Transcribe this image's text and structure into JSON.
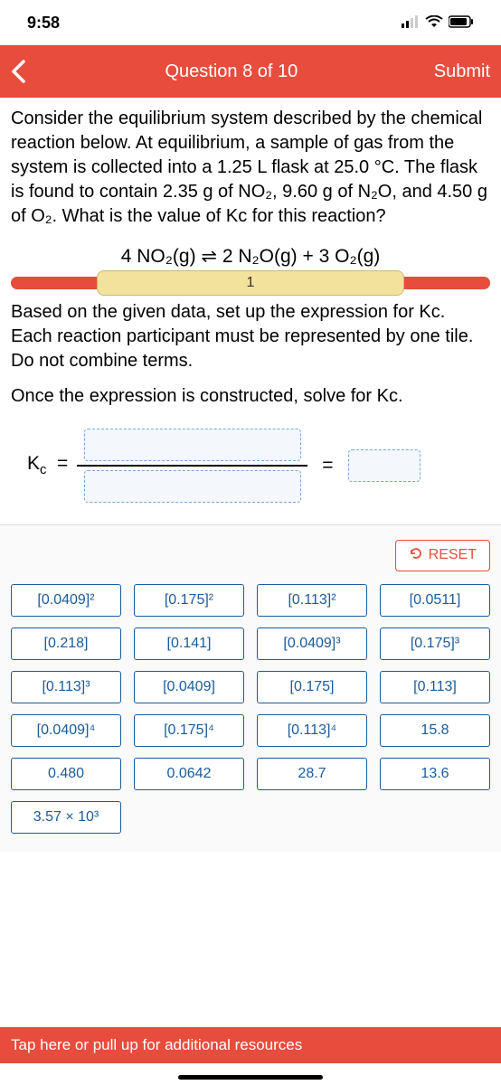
{
  "status": {
    "time": "9:58"
  },
  "nav": {
    "title": "Question 8 of 10",
    "submit": "Submit"
  },
  "question": {
    "prompt": "Consider the equilibrium system described by the chemical reaction below. At equilibrium, a sample of gas from the system is collected into a 1.25 L flask at 25.0 °C. The flask is found to contain 2.35 g of NO₂, 9.60 g of N₂O, and 4.50 g of O₂. What is the value of Kc for this reaction?",
    "equation": "4 NO₂(g)  ⇌ 2 N₂O(g) + 3 O₂(g)",
    "step": "1",
    "instruction1": "Based on the given data, set up the expression for Kc. Each reaction participant must be represented by one tile. Do not combine terms.",
    "instruction2": "Once the expression is constructed, solve for Kc.",
    "kc_label": "Kc  ="
  },
  "reset": "RESET",
  "tiles": [
    "[0.0409]²",
    "[0.175]²",
    "[0.113]²",
    "[0.0511]",
    "[0.218]",
    "[0.141]",
    "[0.0409]³",
    "[0.175]³",
    "[0.113]³",
    "[0.0409]",
    "[0.175]",
    "[0.113]",
    "[0.0409]⁴",
    "[0.175]⁴",
    "[0.113]⁴",
    "15.8",
    "0.480",
    "0.0642",
    "28.7",
    "13.6",
    "3.57 × 10³"
  ],
  "footer": "Tap here or pull up for additional resources"
}
